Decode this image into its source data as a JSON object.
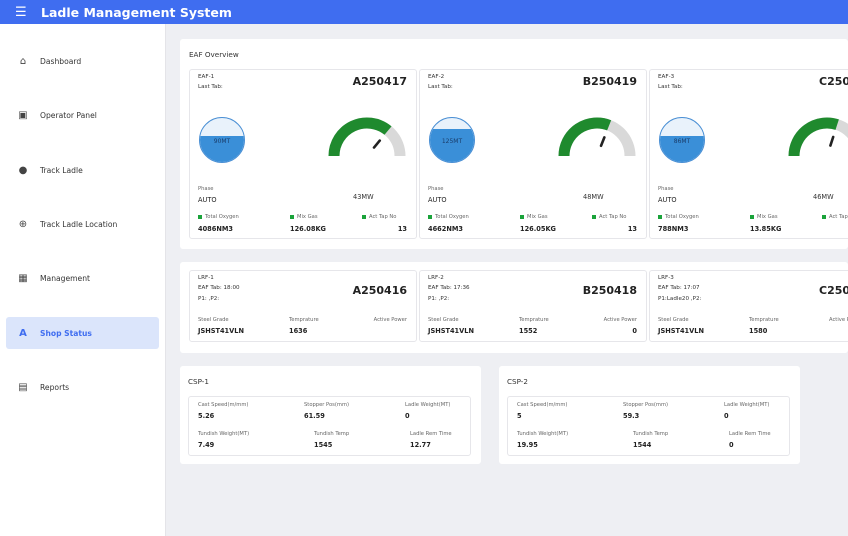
{
  "app": {
    "title": "Ladle Management System"
  },
  "sidebar": {
    "items": [
      {
        "label": "Dashboard",
        "icon": "home-icon"
      },
      {
        "label": "Operator Panel",
        "icon": "calendar-icon"
      },
      {
        "label": "Track Ladle",
        "icon": "location-pin-icon"
      },
      {
        "label": "Track Ladle Location",
        "icon": "crosshair-icon"
      },
      {
        "label": "Management",
        "icon": "grid-icon"
      },
      {
        "label": "Shop Status",
        "icon": "triangle-icon",
        "active": true
      },
      {
        "label": "Reports",
        "icon": "clipboard-icon"
      }
    ]
  },
  "eaf": {
    "title": "EAF Overview",
    "labels": {
      "last_tab": "Last Tab:",
      "phase": "Phase",
      "total_oxygen": "Total Oxygen",
      "mix_gas": "Mix Gas",
      "act_tap_no": "Act Tap No"
    },
    "cards": [
      {
        "name": "EAF-1",
        "code": "A250417",
        "ladle": "90MT",
        "ladle_level": 0.6,
        "power": "43MW",
        "power_level": 0.72,
        "phase": "AUTO",
        "oxygen": "4086NM3",
        "mix_gas": "126.08KG",
        "tap_no": "13"
      },
      {
        "name": "EAF-2",
        "code": "B250419",
        "ladle": "125MT",
        "ladle_level": 0.75,
        "power": "48MW",
        "power_level": 0.62,
        "phase": "AUTO",
        "oxygen": "4662NM3",
        "mix_gas": "126.05KG",
        "tap_no": "13"
      },
      {
        "name": "EAF-3",
        "code": "C250",
        "ladle": "86MT",
        "ladle_level": 0.6,
        "power": "46MW",
        "power_level": 0.6,
        "phase": "AUTO",
        "oxygen": "788NM3",
        "mix_gas": "13.85KG",
        "tap_no": ""
      }
    ]
  },
  "lrf": {
    "labels": {
      "steel_grade": "Steel Grade",
      "temperature": "Temprature",
      "active_power": "Active Power"
    },
    "cards": [
      {
        "name": "LRF-1",
        "tab": "EAF Tab: 18:00",
        "positions": "P1: ,P2:",
        "code": "A250416",
        "grade": "JSHST41VLN",
        "temp": "1636",
        "power": ""
      },
      {
        "name": "LRF-2",
        "tab": "EAF Tab: 17:36",
        "positions": "P1: ,P2:",
        "code": "B250418",
        "grade": "JSHST41VLN",
        "temp": "1552",
        "power": "0"
      },
      {
        "name": "LRF-3",
        "tab": "EAF Tab: 17:07",
        "positions": "P1:Ladle20 ,P2:",
        "code": "C250",
        "grade": "JSHST41VLN",
        "temp": "1580",
        "power": ""
      }
    ]
  },
  "csp": {
    "labels": {
      "cast_speed": "Cast Speed(m/mm)",
      "stopper_pos": "Stopper Pos(mm)",
      "ladle_weight": "Ladle Weight(MT)",
      "tundish_weight": "Tundish Weight(MT)",
      "tundish_temp": "Tundish Temp",
      "ladle_rem_time": "Ladle Rem Time"
    },
    "panels": [
      {
        "title": "CSP-1",
        "cast_speed": "5.26",
        "stopper_pos": "61.59",
        "ladle_weight": "0",
        "tundish_weight": "7.49",
        "tundish_temp": "1545",
        "ladle_rem_time": "12.77"
      },
      {
        "title": "CSP-2",
        "cast_speed": "5",
        "stopper_pos": "59.3",
        "ladle_weight": "0",
        "tundish_weight": "19.95",
        "tundish_temp": "1544",
        "ladle_rem_time": "0"
      }
    ]
  },
  "colors": {
    "accent": "#3f6df0",
    "gauge_on": "#1f8a2e",
    "gauge_off": "#d9d9d9",
    "ladle_fill": "#3a8fd8"
  }
}
